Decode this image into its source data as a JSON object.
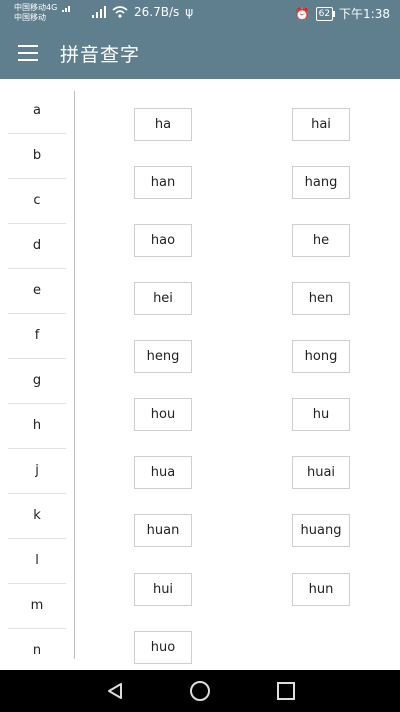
{
  "status_bar": {
    "carrier1": "中国移动4G",
    "carrier2": "中国移动",
    "speed": "26.7B/s",
    "battery": "62",
    "time": "下午1:38"
  },
  "app_bar": {
    "title": "拼音查字"
  },
  "letters": [
    "a",
    "b",
    "c",
    "d",
    "e",
    "f",
    "g",
    "h",
    "j",
    "k",
    "l",
    "m",
    "n"
  ],
  "syllables": [
    "ha",
    "hai",
    "han",
    "hang",
    "hao",
    "he",
    "hei",
    "hen",
    "heng",
    "hong",
    "hou",
    "hu",
    "hua",
    "huai",
    "huan",
    "huang",
    "hui",
    "hun",
    "huo"
  ]
}
